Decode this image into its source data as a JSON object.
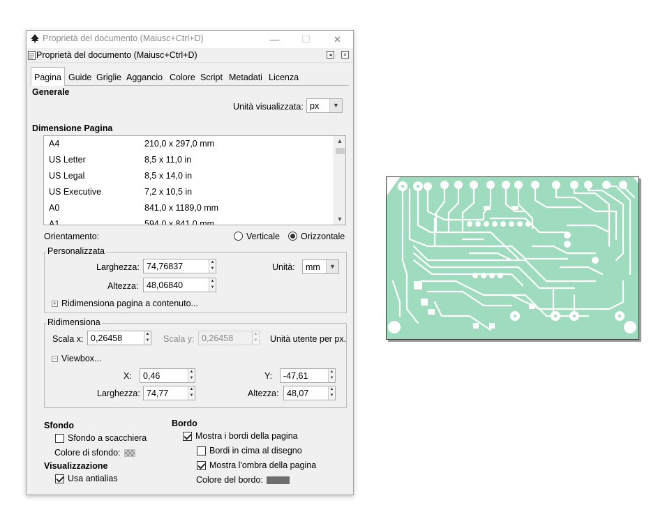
{
  "window": {
    "title": "Proprietà del documento (Maiusc+Ctrl+D)",
    "dock_title": "Proprietà del documento (Maiusc+Ctrl+D)",
    "minimize": "—",
    "maximize": "☐",
    "close": "✕"
  },
  "tabs": [
    {
      "label": "Pagina",
      "active": true
    },
    {
      "label": "Guide"
    },
    {
      "label": "Griglie"
    },
    {
      "label": "Aggancio"
    },
    {
      "label": "Colore"
    },
    {
      "label": "Script"
    },
    {
      "label": "Metadati"
    },
    {
      "label": "Licenza"
    }
  ],
  "generale": {
    "heading": "Generale",
    "unit_label": "Unità visualizzata:",
    "unit_value": "px"
  },
  "dimensione": {
    "heading": "Dimensione Pagina",
    "rows": [
      {
        "name": "A4",
        "size": "210,0 x 297,0 mm"
      },
      {
        "name": "US Letter",
        "size": "8,5 x 11,0 in"
      },
      {
        "name": "US Legal",
        "size": "8,5 x 14,0 in"
      },
      {
        "name": "US Executive",
        "size": "7,2 x 10,5 in"
      },
      {
        "name": "A0",
        "size": "841,0 x 1189,0 mm"
      },
      {
        "name": "A1",
        "size": "594,0 x 841,0 mm"
      }
    ]
  },
  "orientamento": {
    "label": "Orientamento:",
    "verticale": "Verticale",
    "orizzontale": "Orizzontale",
    "selected": "orizzontale"
  },
  "personalizzata": {
    "title": "Personalizzata",
    "larghezza_label": "Larghezza:",
    "larghezza_value": "74,76837",
    "altezza_label": "Altezza:",
    "altezza_value": "48,06840",
    "unita_label": "Unità:",
    "unita_value": "mm",
    "resize_label": "Ridimensiona pagina a contenuto..."
  },
  "ridimensiona": {
    "title": "Ridimensiona",
    "scala_x_label": "Scala x:",
    "scala_x_value": "0,26458",
    "scala_y_label": "Scala y:",
    "scala_y_value": "0,26458",
    "unit_text": "Unità utente per px.",
    "viewbox_label": "Viewbox...",
    "x_label": "X:",
    "x_value": "0,46",
    "y_label": "Y:",
    "y_value": "-47,61",
    "larghezza_label": "Larghezza:",
    "larghezza_value": "74,77",
    "altezza_label": "Altezza:",
    "altezza_value": "48,07"
  },
  "sfondo": {
    "heading": "Sfondo",
    "scacchiera_label": "Sfondo a scacchiera",
    "scacchiera_checked": false,
    "colore_label": "Colore di sfondo:"
  },
  "visualizzazione": {
    "heading": "Visualizzazione",
    "antialias_label": "Usa antialias",
    "antialias_checked": true
  },
  "bordo": {
    "heading": "Bordo",
    "mostra_label": "Mostra i bordi della pagina",
    "mostra_checked": true,
    "cima_label": "Bordi in cima al disegno",
    "cima_checked": false,
    "ombra_label": "Mostra l'ombra della pagina",
    "ombra_checked": true,
    "colore_label": "Colore del bordo:",
    "colore_value": "#6e6e6e"
  },
  "canvas": {
    "pcb_color": "#9fdcbf",
    "page_border": "#333333"
  }
}
